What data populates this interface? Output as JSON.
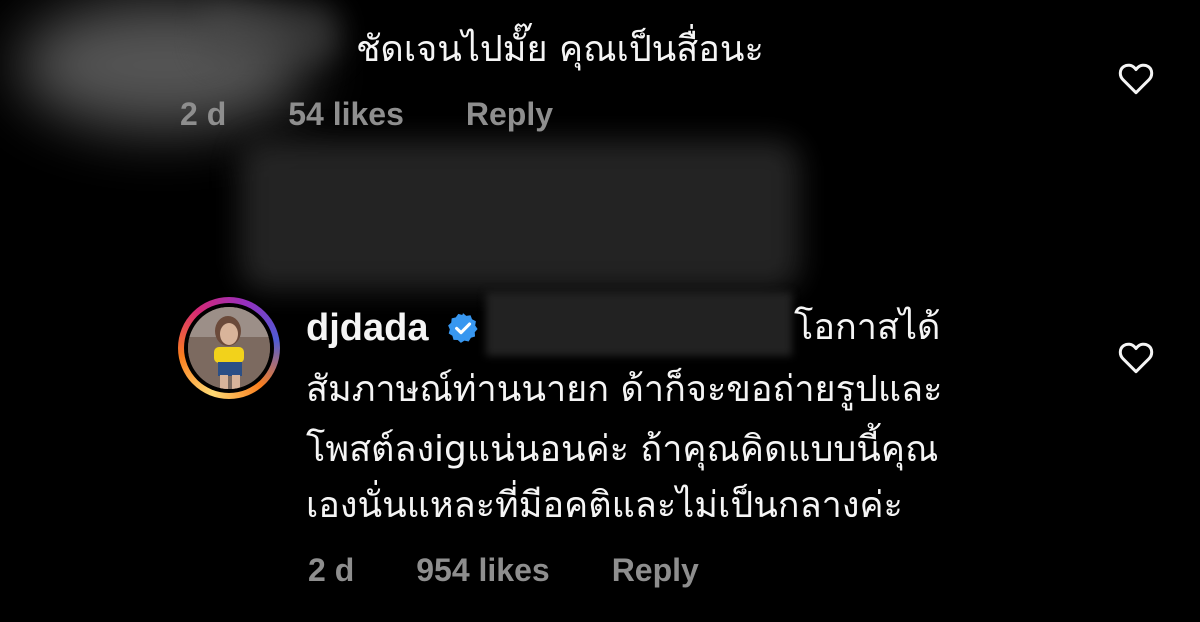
{
  "comment_1": {
    "text": "ชัดเจนไปมั๊ย คุณเป็นสื่อนะ",
    "time": "2 d",
    "likes": "54 likes",
    "reply_label": "Reply"
  },
  "comment_2": {
    "username": "djdada",
    "text_line_1": "โอกาสได้",
    "text_line_2": "สัมภาษณ์ท่านนายก ด้าก็จะขอถ่ายรูปและ",
    "text_line_3": "โพสต์ลงigแน่นอนค่ะ ถ้าคุณคิดแบบนี้คุณ",
    "text_line_4": "เองนั่นแหละที่มีอคติและไม่เป็นกลางค่ะ",
    "time": "2 d",
    "likes": "954 likes",
    "reply_label": "Reply"
  },
  "colors": {
    "background": "#000000",
    "text": "#f5f5f5",
    "meta": "#8e8e8e",
    "verified": "#3897f0"
  },
  "icons": {
    "like": "heart-outline-icon",
    "verified": "verified-badge-icon"
  }
}
